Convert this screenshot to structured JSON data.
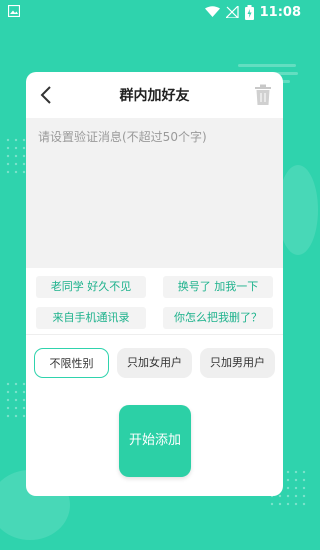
{
  "status_bar": {
    "time": "11:08"
  },
  "dialog": {
    "title": "群内加好友",
    "message_placeholder": "请设置验证消息(不超过50个字)",
    "quick_messages": [
      "老同学 好久不见",
      "换号了 加我一下",
      "来自手机通讯录",
      "你怎么把我删了？"
    ],
    "gender_filters": [
      {
        "label": "不限性别",
        "selected": true
      },
      {
        "label": "只加女用户",
        "selected": false
      },
      {
        "label": "只加男用户",
        "selected": false
      }
    ],
    "start_button_label": "开始添加"
  },
  "colors": {
    "background": "#2fd3ad",
    "accent_text": "#1db28c",
    "button": "#2cd0a6"
  }
}
